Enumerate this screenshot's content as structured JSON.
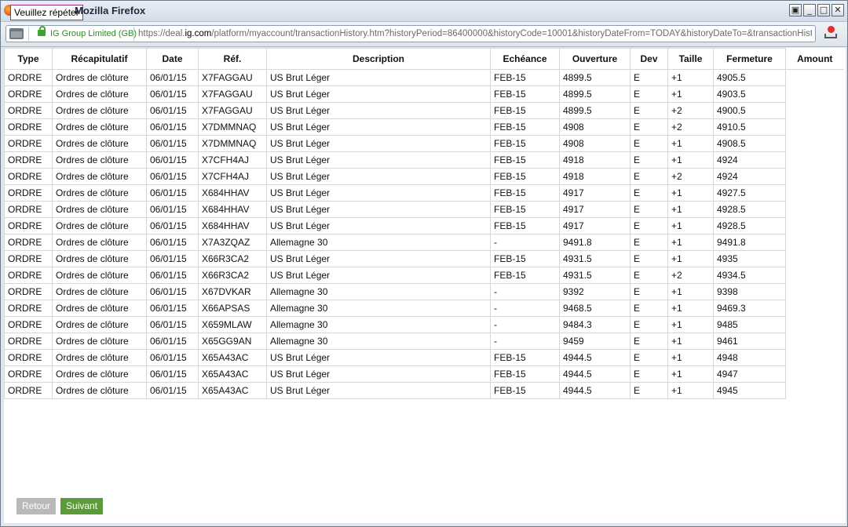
{
  "window": {
    "title": "Mozilla Firefox",
    "tooltip": "Veuillez répéter",
    "controls": [
      "restore",
      "minimize",
      "maximize",
      "close"
    ]
  },
  "urlbar": {
    "identity": "IG Group Limited (GB)",
    "url_prefix": "https://deal.",
    "url_domain": "ig.com",
    "url_rest": "/platform/myaccount/transactionHistory.htm?historyPeriod=86400000&historyCode=10001&historyDateFrom=TODAY&historyDateTo=&transactionHistoryPag"
  },
  "table": {
    "headers": [
      "Type",
      "Récapitulatif",
      "Date",
      "Réf.",
      "Description",
      "Echéance",
      "Ouverture",
      "Dev",
      "Taille",
      "Fermeture",
      "Amount"
    ],
    "rows": [
      [
        "ORDRE",
        "Ordres de clôture",
        "06/01/15",
        "X7FAGGAU",
        "US Brut Léger",
        "FEB-15",
        "4899.5",
        "E",
        "+1",
        "4905.5"
      ],
      [
        "ORDRE",
        "Ordres de clôture",
        "06/01/15",
        "X7FAGGAU",
        "US Brut Léger",
        "FEB-15",
        "4899.5",
        "E",
        "+1",
        "4903.5"
      ],
      [
        "ORDRE",
        "Ordres de clôture",
        "06/01/15",
        "X7FAGGAU",
        "US Brut Léger",
        "FEB-15",
        "4899.5",
        "E",
        "+2",
        "4900.5"
      ],
      [
        "ORDRE",
        "Ordres de clôture",
        "06/01/15",
        "X7DMMNAQ",
        "US Brut Léger",
        "FEB-15",
        "4908",
        "E",
        "+2",
        "4910.5"
      ],
      [
        "ORDRE",
        "Ordres de clôture",
        "06/01/15",
        "X7DMMNAQ",
        "US Brut Léger",
        "FEB-15",
        "4908",
        "E",
        "+1",
        "4908.5"
      ],
      [
        "ORDRE",
        "Ordres de clôture",
        "06/01/15",
        "X7CFH4AJ",
        "US Brut Léger",
        "FEB-15",
        "4918",
        "E",
        "+1",
        "4924"
      ],
      [
        "ORDRE",
        "Ordres de clôture",
        "06/01/15",
        "X7CFH4AJ",
        "US Brut Léger",
        "FEB-15",
        "4918",
        "E",
        "+2",
        "4924"
      ],
      [
        "ORDRE",
        "Ordres de clôture",
        "06/01/15",
        "X684HHAV",
        "US Brut Léger",
        "FEB-15",
        "4917",
        "E",
        "+1",
        "4927.5"
      ],
      [
        "ORDRE",
        "Ordres de clôture",
        "06/01/15",
        "X684HHAV",
        "US Brut Léger",
        "FEB-15",
        "4917",
        "E",
        "+1",
        "4928.5"
      ],
      [
        "ORDRE",
        "Ordres de clôture",
        "06/01/15",
        "X684HHAV",
        "US Brut Léger",
        "FEB-15",
        "4917",
        "E",
        "+1",
        "4928.5"
      ],
      [
        "ORDRE",
        "Ordres de clôture",
        "06/01/15",
        "X7A3ZQAZ",
        "Allemagne 30",
        "-",
        "9491.8",
        "E",
        "+1",
        "9491.8"
      ],
      [
        "ORDRE",
        "Ordres de clôture",
        "06/01/15",
        "X66R3CA2",
        "US Brut Léger",
        "FEB-15",
        "4931.5",
        "E",
        "+1",
        "4935"
      ],
      [
        "ORDRE",
        "Ordres de clôture",
        "06/01/15",
        "X66R3CA2",
        "US Brut Léger",
        "FEB-15",
        "4931.5",
        "E",
        "+2",
        "4934.5"
      ],
      [
        "ORDRE",
        "Ordres de clôture",
        "06/01/15",
        "X67DVKAR",
        "Allemagne 30",
        "-",
        "9392",
        "E",
        "+1",
        "9398"
      ],
      [
        "ORDRE",
        "Ordres de clôture",
        "06/01/15",
        "X66APSAS",
        "Allemagne 30",
        "-",
        "9468.5",
        "E",
        "+1",
        "9469.3"
      ],
      [
        "ORDRE",
        "Ordres de clôture",
        "06/01/15",
        "X659MLAW",
        "Allemagne 30",
        "-",
        "9484.3",
        "E",
        "+1",
        "9485"
      ],
      [
        "ORDRE",
        "Ordres de clôture",
        "06/01/15",
        "X65GG9AN",
        "Allemagne 30",
        "-",
        "9459",
        "E",
        "+1",
        "9461"
      ],
      [
        "ORDRE",
        "Ordres de clôture",
        "06/01/15",
        "X65A43AC",
        "US Brut Léger",
        "FEB-15",
        "4944.5",
        "E",
        "+1",
        "4948"
      ],
      [
        "ORDRE",
        "Ordres de clôture",
        "06/01/15",
        "X65A43AC",
        "US Brut Léger",
        "FEB-15",
        "4944.5",
        "E",
        "+1",
        "4947"
      ],
      [
        "ORDRE",
        "Ordres de clôture",
        "06/01/15",
        "X65A43AC",
        "US Brut Léger",
        "FEB-15",
        "4944.5",
        "E",
        "+1",
        "4945"
      ]
    ]
  },
  "pagination": {
    "prev_label": "Retour",
    "next_label": "Suivant"
  }
}
